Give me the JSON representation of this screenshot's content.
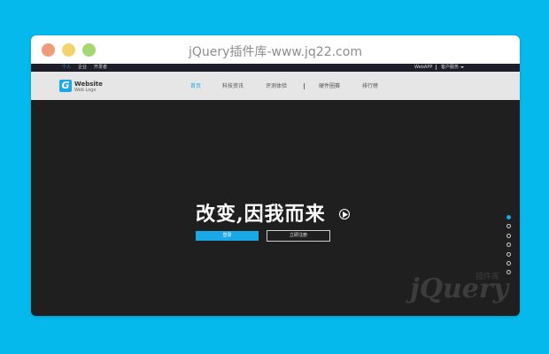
{
  "window": {
    "title": "jQuery插件库-www.jq22.com"
  },
  "topbar": {
    "left_links": [
      "个人",
      "企业",
      "开发者"
    ],
    "right_links": [
      "WebAPP",
      "客户服务"
    ]
  },
  "navbar": {
    "logo": {
      "title": "Website",
      "subtitle": "Web Logo",
      "letter": "G"
    },
    "items": [
      "首页",
      "科技资讯",
      "评测体验",
      "硬件圈赛",
      "排行榜"
    ],
    "active_index": 0
  },
  "hero": {
    "slogan": "改变,因我而来",
    "login_label": "登录",
    "register_label": "立即注册",
    "slide_count": 7,
    "active_slide": 1
  },
  "watermark": {
    "text": "jQuery",
    "cn": "插件库"
  },
  "colors": {
    "page_background": "#05b9ec",
    "accent": "#1aa8e6",
    "hero_background": "#1f1f1f",
    "nav_background": "#e6e6e6",
    "topbar_background": "#1e1e2a"
  },
  "icons": {
    "window_controls": [
      "close-dot",
      "minimize-dot",
      "maximize-dot"
    ],
    "play": "play-circle-icon",
    "caret": "caret-down-icon"
  }
}
